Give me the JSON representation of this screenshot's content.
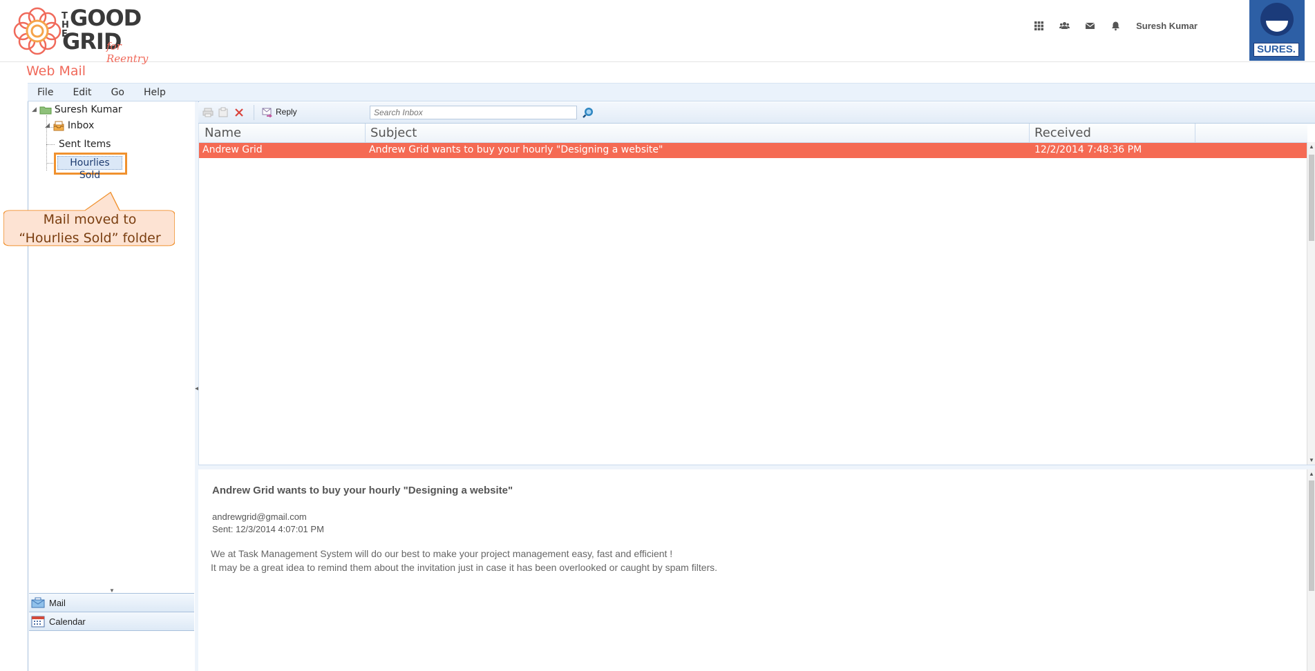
{
  "header": {
    "logo": {
      "line1": "THE",
      "line2": "GOOD",
      "line3": "GRID",
      "tagline": "for Reentry"
    },
    "icons": [
      "grid-icon",
      "users-icon",
      "mail-icon",
      "bell-icon"
    ],
    "user_name": "Suresh Kumar",
    "avatar_label": "SURES."
  },
  "app": {
    "title": "Web Mail"
  },
  "menu": {
    "items": [
      "File",
      "Edit",
      "Go",
      "Help"
    ]
  },
  "tree": {
    "root": "Suresh Kumar",
    "inbox": "Inbox",
    "sent": "Sent Items",
    "selected_folder": "Hourlies Sold"
  },
  "callout": {
    "line1": "Mail moved to",
    "line2": "“Hourlies Sold” folder"
  },
  "nav": {
    "mail": "Mail",
    "calendar": "Calendar"
  },
  "toolbar": {
    "reply": "Reply",
    "search_placeholder": "Search Inbox"
  },
  "grid": {
    "columns": [
      "Name",
      "Subject",
      "Received"
    ],
    "rows": [
      {
        "name": "Andrew Grid",
        "subject": "Andrew Grid wants to buy your hourly \"Designing a website\"",
        "received": "12/2/2014 7:48:36 PM"
      }
    ]
  },
  "preview": {
    "subject": "Andrew Grid wants to buy your hourly \"Designing a website\"",
    "from": "andrewgrid@gmail.com",
    "sent": "Sent: 12/3/2014 4:07:01 PM",
    "body_line1": "We at Task Management System will do our best to make your project management easy, fast and efficient !",
    "body_line2": "It may be a great idea to remind them about the invitation just in case it has been overlooked or caught by spam filters."
  },
  "colors": {
    "accent": "#f56a53",
    "title": "#f0695a",
    "callout_border": "#f0912e",
    "avatar": "#2d5fa5"
  }
}
